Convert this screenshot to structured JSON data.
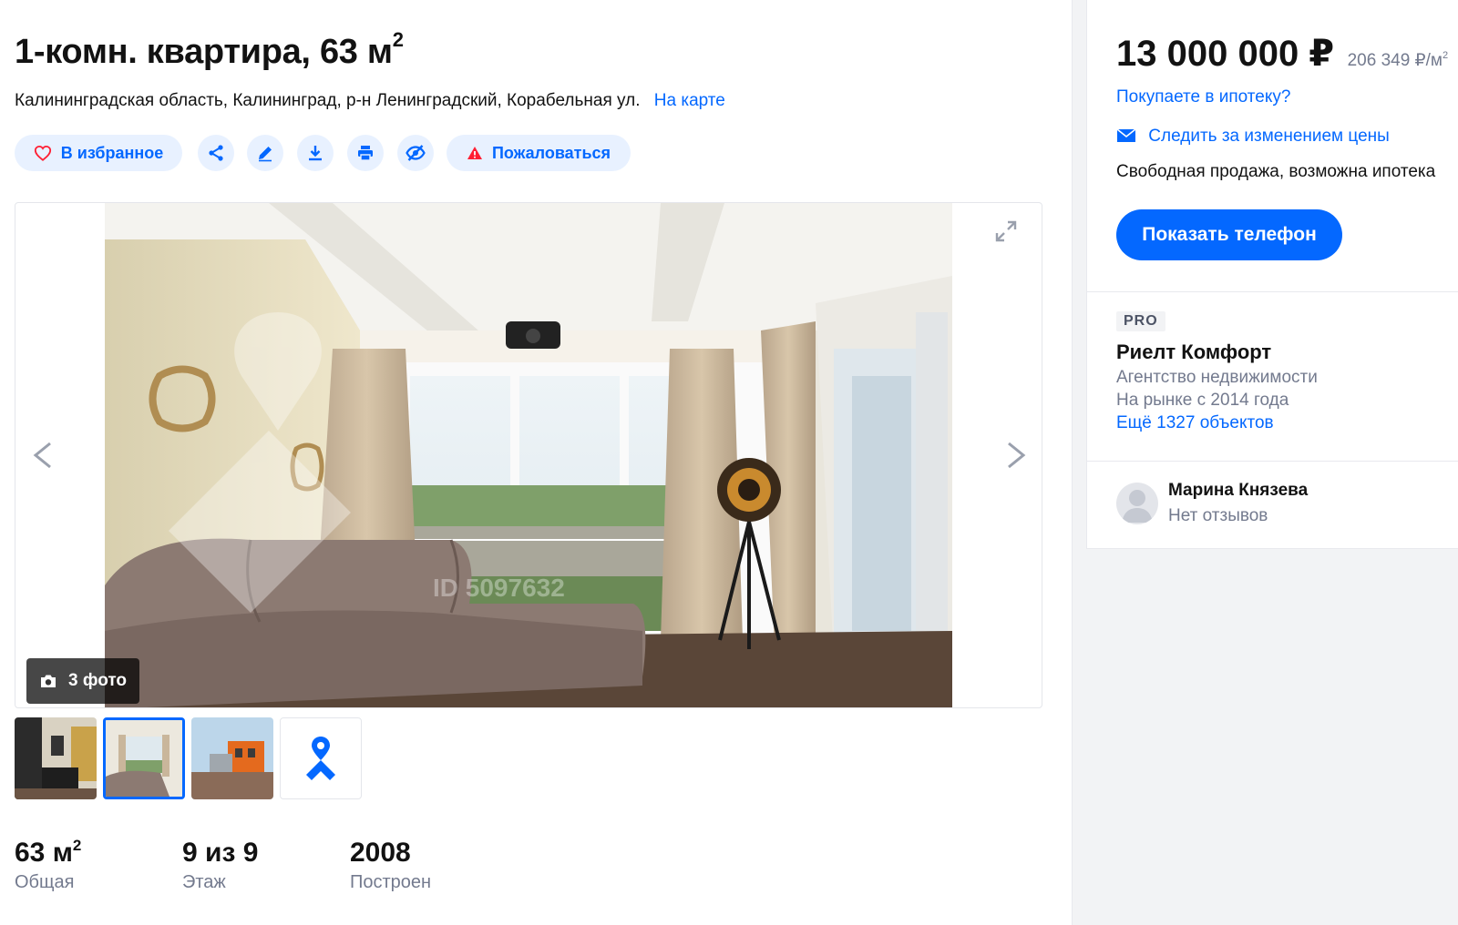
{
  "listing": {
    "title": "1-комн. квартира, 63 м",
    "title_sup": "2",
    "address": "Калининградская область, Калининград, р-н Ленинградский, Корабельная ул.",
    "map_link": "На карте"
  },
  "actions": {
    "favorite": "В избранное",
    "complain": "Пожаловаться",
    "icons": [
      "share-icon",
      "pencil-icon",
      "download-icon",
      "print-icon",
      "hide-icon"
    ]
  },
  "gallery": {
    "photo_count": "3 фото",
    "watermark": "ID 5097632",
    "thumbnails": [
      "kitchen-photo",
      "living-room-photo",
      "building-photo",
      "map-pin"
    ]
  },
  "facts": [
    {
      "value": "63 м",
      "sup": "2",
      "caption": "Общая"
    },
    {
      "value": "9 из 9",
      "caption": "Этаж"
    },
    {
      "value": "2008",
      "caption": "Построен"
    }
  ],
  "sidebar": {
    "price": "13 000 000 ₽",
    "price_per_m": "206 349 ₽/м",
    "price_per_m_sup": "2",
    "mortgage_link": "Покупаете в ипотеку?",
    "track_price": "Следить за изменением цены",
    "sale_type": "Свободная продажа, возможна ипотека",
    "show_phone": "Показать телефон",
    "pro_badge": "PRO",
    "agency_name": "Риелт Комфорт",
    "agency_type": "Агентство недвижимости",
    "on_market": "На рынке с 2014 года",
    "more_objects": "Ещё 1327 объектов",
    "agent_name": "Марина Князева",
    "agent_reviews": "Нет отзывов"
  },
  "colors": {
    "accent": "#0468ff",
    "pill_bg": "#e8f1ff",
    "danger": "#ff1f34",
    "text": "#121212",
    "muted": "#737a8e"
  }
}
